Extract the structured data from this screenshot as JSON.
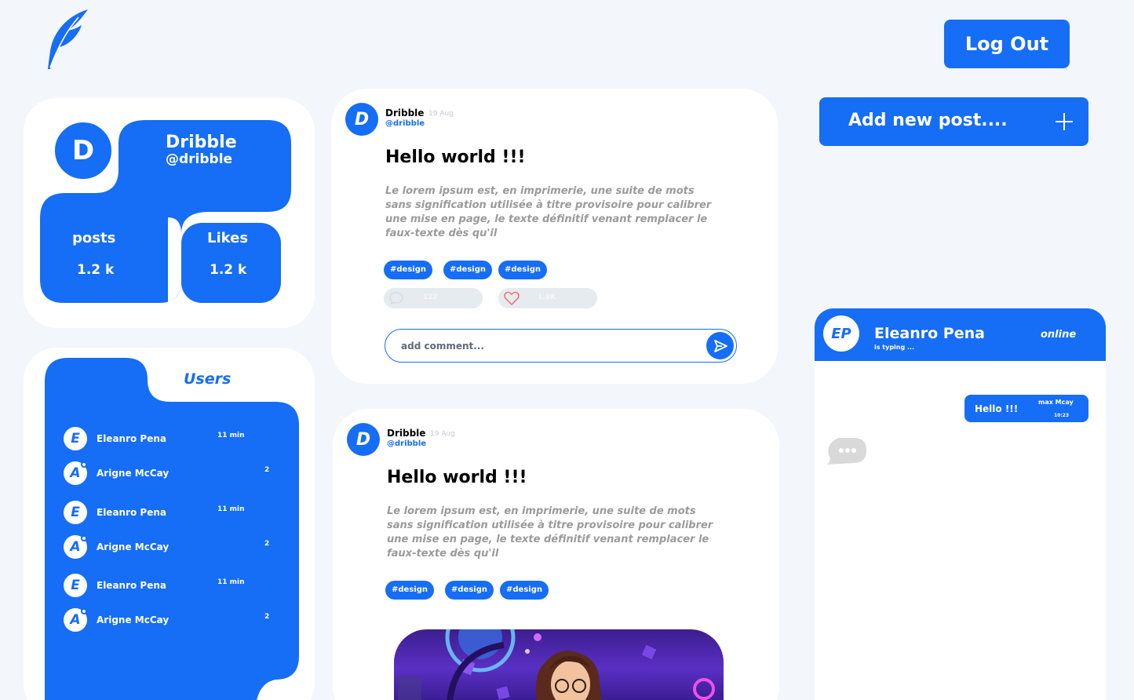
{
  "app": {
    "accent": "#166df6",
    "background": "#f3f6fa"
  },
  "header": {
    "logo_icon": "feather-icon",
    "logout_label": "Log Out"
  },
  "profile": {
    "avatar_letter": "D",
    "name": "Dribble",
    "handle": "@dribble",
    "posts_label": "posts",
    "posts_value": "1.2 k",
    "likes_label": "Likes",
    "likes_value": "1.2 k"
  },
  "users": {
    "title": "Users",
    "items": [
      {
        "initial": "E",
        "name": "Eleanro Pena",
        "time": "11 min"
      },
      {
        "initial": "A",
        "name": "Arigne McCay",
        "time": "2"
      },
      {
        "initial": "E",
        "name": "Eleanro Pena",
        "time": "11 min"
      },
      {
        "initial": "A",
        "name": "Arigne McCay",
        "time": "2"
      },
      {
        "initial": "E",
        "name": "Eleanro Pena",
        "time": "11 min"
      },
      {
        "initial": "A",
        "name": "Arigne McCay",
        "time": "2"
      }
    ]
  },
  "posts": [
    {
      "avatar_letter": "D",
      "author": "Dribble",
      "date": "19 Aug",
      "handle": "@dribble",
      "title": "Hello world !!!",
      "body": "Le lorem ipsum est, en imprimerie, une suite de mots sans signification utilisée à titre provisoire pour calibrer une mise en page, le texte définitif venant remplacer le faux-texte dès qu'il",
      "tags": [
        "#design",
        "#design",
        "#design"
      ],
      "comments_count": "122",
      "likes_count": "1.8K",
      "comment_placeholder": "add comment..."
    },
    {
      "avatar_letter": "D",
      "author": "Dribble",
      "date": "19 Aug",
      "handle": "@dribble",
      "title": "Hello world !!!",
      "body": "Le lorem ipsum est, en imprimerie, une suite de mots sans signification utilisée à titre provisoire pour calibrer une mise en page, le texte définitif venant remplacer le faux-texte dès qu'il",
      "tags": [
        "#design",
        "#design",
        "#design"
      ]
    }
  ],
  "add_post": {
    "label": "Add new post....",
    "icon": "plus-icon"
  },
  "chat": {
    "avatar_initials": "EP",
    "name": "Eleanro Pena",
    "typing": "is typing ...",
    "status": "online",
    "message": {
      "text": "Hello !!!",
      "sender": "max Mcay",
      "time": "10:23"
    }
  }
}
